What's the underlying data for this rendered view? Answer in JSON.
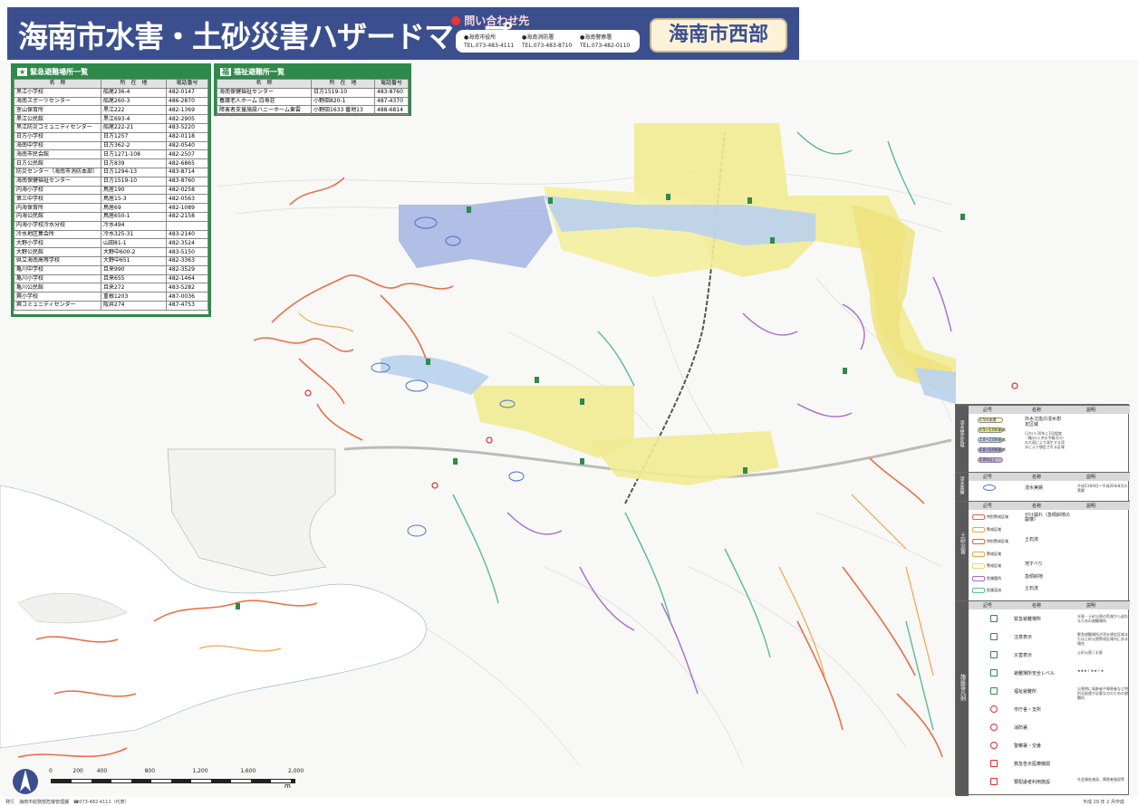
{
  "header": {
    "title": "海南市水害・土砂災害ハザードマップ",
    "region": "海南市西部",
    "contact_title": "問い合わせ先",
    "contacts": [
      {
        "name": "●海南市役所",
        "tel": "TEL.073-483-4111"
      },
      {
        "name": "●海南消防署",
        "tel": "TEL.073-483-8710"
      },
      {
        "name": "●海南警察署",
        "tel": "TEL.073-482-0110"
      }
    ]
  },
  "evac_panel": {
    "title": "緊急避難場所一覧",
    "columns": [
      "名　称",
      "所　在　地",
      "電話番号"
    ],
    "rows": [
      [
        "黒江小学校",
        "船尾236-4",
        "482-0147"
      ],
      [
        "海南スポーツセンター",
        "船尾260-3",
        "486-2870"
      ],
      [
        "室山保育所",
        "黒江222",
        "482-1369"
      ],
      [
        "黒江公民館",
        "黒江693-4",
        "482-2905"
      ],
      [
        "黒江防災コミュニティセンター",
        "船尾222-21",
        "483-5220"
      ],
      [
        "日方小学校",
        "日方1257",
        "482-0118"
      ],
      [
        "海南中学校",
        "日方362-2",
        "482-0540"
      ],
      [
        "海南市民会館",
        "日方1271-108",
        "482-2507"
      ],
      [
        "日方公民館",
        "日方839",
        "482-6865"
      ],
      [
        "防災センター（海南市消防本部）",
        "日方1294-13",
        "483-8714"
      ],
      [
        "海南保健福祉センター",
        "日方1519-10",
        "483-8760"
      ],
      [
        "内海小学校",
        "鳥居190",
        "482-0258"
      ],
      [
        "第三中学校",
        "鳥居15-3",
        "482-0563"
      ],
      [
        "内海保育所",
        "鳥居69",
        "482-1089"
      ],
      [
        "内海公民館",
        "鳥居650-1",
        "482-2158"
      ],
      [
        "内海小学校冷水分校",
        "冷水494",
        ""
      ],
      [
        "冷水地区集会所",
        "冷水325-31",
        "483-2140"
      ],
      [
        "大野小学校",
        "山田81-1",
        "482-3524"
      ],
      [
        "大野公民館",
        "大野中600-2",
        "483-5150"
      ],
      [
        "県立海南高等学校",
        "大野中651",
        "482-3363"
      ],
      [
        "亀川中学校",
        "且来990",
        "482-3529"
      ],
      [
        "亀川小学校",
        "且来655",
        "482-1464"
      ],
      [
        "亀川公民館",
        "且来272",
        "483-5282"
      ],
      [
        "巽小学校",
        "重根1203",
        "487-0036"
      ],
      [
        "巽コミュニティセンター",
        "阪井274",
        "487-4753"
      ]
    ]
  },
  "welfare_panel": {
    "title": "福祉避難所一覧",
    "columns": [
      "名　称",
      "所　在　地",
      "電話番号"
    ],
    "rows": [
      [
        "海南保健福祉センター",
        "日方1519-10",
        "483-8760"
      ],
      [
        "養護老人ホーム 白寿荘",
        "小野田820-1",
        "487-4370"
      ],
      [
        "障害者支援施設ハニーホーム東雲",
        "小野田1633 番地13",
        "488-6814"
      ]
    ]
  },
  "legend": {
    "columns": [
      "記号",
      "名称",
      "説明"
    ],
    "flood_side": "浸水想定区域",
    "flood_name": "外水氾濫の浸水想定区域",
    "flood_desc": "日方川:30年に1回程度（亀の川:洪水予報河川）の大雨により発生する浸水により想定される区域",
    "flood_items": [
      {
        "label": "0.5m未満",
        "color": "#fbf5b8"
      },
      {
        "label": "0.5〜1.0m未満",
        "color": "#eee57a"
      },
      {
        "label": "1.0〜2.0m未満",
        "color": "#b8d4ef"
      },
      {
        "label": "2.0〜5.0m未満",
        "color": "#a9a8e0"
      },
      {
        "label": "5.0m以上",
        "color": "#c9a6e4"
      }
    ],
    "inundation_side": "浸水実績",
    "inundation_name": "浸水実績",
    "inundation_desc": "平成23年9月〜平成26年8月の実績",
    "sediment_side": "土砂災害",
    "sediment_items": [
      {
        "name": "がけ崩れ（急傾斜地の崩壊）",
        "label": "特別警戒区域",
        "color": "#e8604a"
      },
      {
        "name": "",
        "label": "警戒区域",
        "color": "#f2a24a"
      },
      {
        "name": "土石流",
        "label": "特別警戒区域",
        "color": "#e8604a"
      },
      {
        "name": "",
        "label": "警戒区域",
        "color": "#f2a24a"
      },
      {
        "name": "地すべり",
        "label": "警戒区域",
        "color": "#f7d16a"
      },
      {
        "name": "急傾斜地",
        "label": "危険箇所",
        "color": "#a869c9"
      },
      {
        "name": "土石流",
        "label": "危険渓流",
        "color": "#5cb99a"
      }
    ],
    "facility_side": "施設等凡例",
    "facility_items": [
      {
        "name": "緊急避難場所",
        "desc": "水害・土砂災害の危険から逃れるための避難場所"
      },
      {
        "name": "注意表示",
        "desc": "緊急避難場所が浸水想定区域または土砂災害警戒区域内にある場合"
      },
      {
        "name": "災害表示",
        "desc": "土砂災害 / 水害"
      },
      {
        "name": "避難場所安全レベル",
        "desc": "★★★ / ★★ / ★"
      },
      {
        "name": "福祉避難所",
        "desc": "災害時に高齢者や障害者など特別な配慮が必要な方のための避難所"
      },
      {
        "name": "市庁舎・支所",
        "desc": ""
      },
      {
        "name": "消防署",
        "desc": ""
      },
      {
        "name": "警察署・交番",
        "desc": ""
      },
      {
        "name": "救急告示医療機関",
        "desc": ""
      },
      {
        "name": "要配慮者利用施設",
        "desc": "社会福祉施設、障害者施設等"
      }
    ]
  },
  "scale": {
    "labels": [
      "0",
      "200",
      "400",
      "800",
      "1,200",
      "1,600",
      "2,000"
    ],
    "unit": "m"
  },
  "footer": {
    "publisher": "発行　海南市総務部危機管理課　☎073-482-4111（代表）",
    "date": "平成 29 年 2 月作成"
  }
}
